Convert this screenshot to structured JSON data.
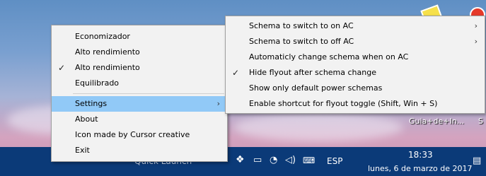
{
  "desktop": {
    "icon_labels": [
      "Guia+de+In...",
      "S"
    ]
  },
  "taskbar": {
    "quick_launch": "Quick Launch",
    "language": "ESP",
    "time": "18:33",
    "date": "lunes, 6 de marzo de 2017",
    "icons": [
      "chevron-up-icon",
      "cursor-icon",
      "dropbox-icon",
      "network-icon",
      "battery-icon",
      "wifi-icon",
      "volume-icon",
      "keyboard-icon",
      "notification-icon"
    ]
  },
  "main_menu": {
    "items": [
      {
        "label": "Economizador",
        "checked": false
      },
      {
        "label": "Alto rendimiento",
        "checked": false
      },
      {
        "label": "Alto rendimiento",
        "checked": true
      },
      {
        "label": "Equilibrado",
        "checked": false
      },
      {
        "label": "Settings",
        "submenu": true,
        "highlighted": true
      },
      {
        "label": "About"
      },
      {
        "label": "Icon made by Cursor creative"
      },
      {
        "label": "Exit"
      }
    ]
  },
  "settings_menu": {
    "items": [
      {
        "label": "Schema to switch to on AC",
        "submenu": true
      },
      {
        "label": "Schema to switch to off AC",
        "submenu": true
      },
      {
        "label": "Automaticly change schema when on AC",
        "checked": false
      },
      {
        "label": "Hide flyout after schema change",
        "checked": true
      },
      {
        "label": "Show only default power schemas",
        "checked": false
      },
      {
        "label": "Enable shortcut for flyout toggle (Shift, Win + S)",
        "checked": false
      }
    ]
  },
  "glyphs": {
    "check": "✓",
    "arrow": "›"
  }
}
